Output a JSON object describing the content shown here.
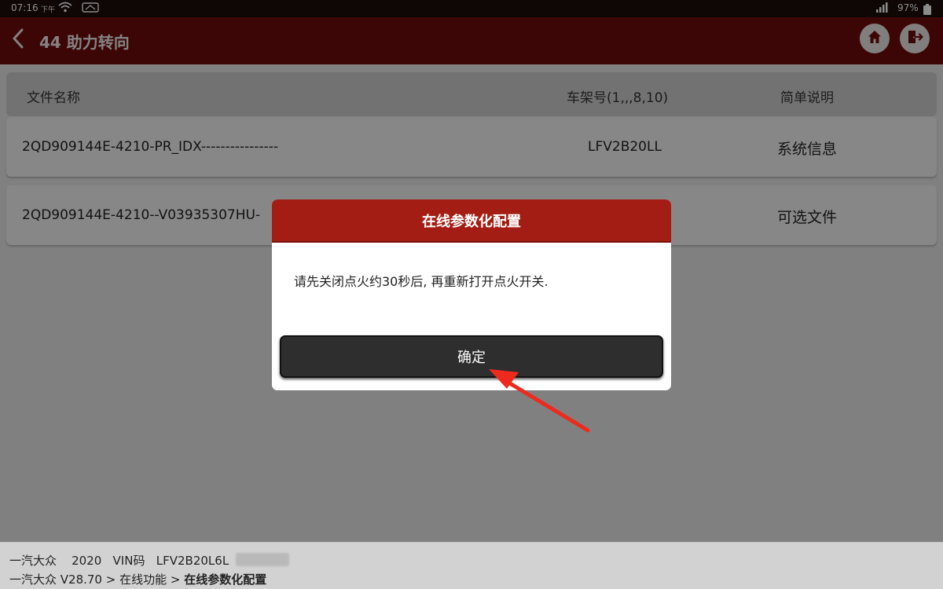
{
  "status_bar": {
    "time": "07:16",
    "ampm": "下午",
    "battery_pct": "97%",
    "icons": [
      "wifi-icon",
      "cast-icon",
      "signal-icon",
      "battery-icon"
    ]
  },
  "header": {
    "title": "44 助力转向",
    "back_icon": "chevron-left-icon",
    "home_icon": "home-icon",
    "exit_icon": "exit-icon",
    "bar_color": "#6e0b0b"
  },
  "table": {
    "columns": [
      "文件名称",
      "车架号(1,,,8,10)",
      "简单说明"
    ],
    "rows": [
      {
        "name": "2QD909144E-4210-PR_IDX----------------",
        "vin": "LFV2B20LL",
        "desc": "系统信息"
      },
      {
        "name": "2QD909144E-4210--V03935307HU-",
        "vin": "",
        "desc": "可选文件"
      }
    ]
  },
  "dialog": {
    "title": "在线参数化配置",
    "message": "请先关闭点火约30秒后, 再重新打开点火开关.",
    "confirm_label": "确定",
    "header_color": "#a41d14"
  },
  "footer": {
    "line1": "一汽大众    2020   VIN码   LFV2B20L6L",
    "breadcrumb_prefix": "一汽大众 V28.70 > 在线功能 > ",
    "breadcrumb_current": "在线参数化配置"
  },
  "annotation": {
    "arrow_color": "#ee2a1d"
  }
}
